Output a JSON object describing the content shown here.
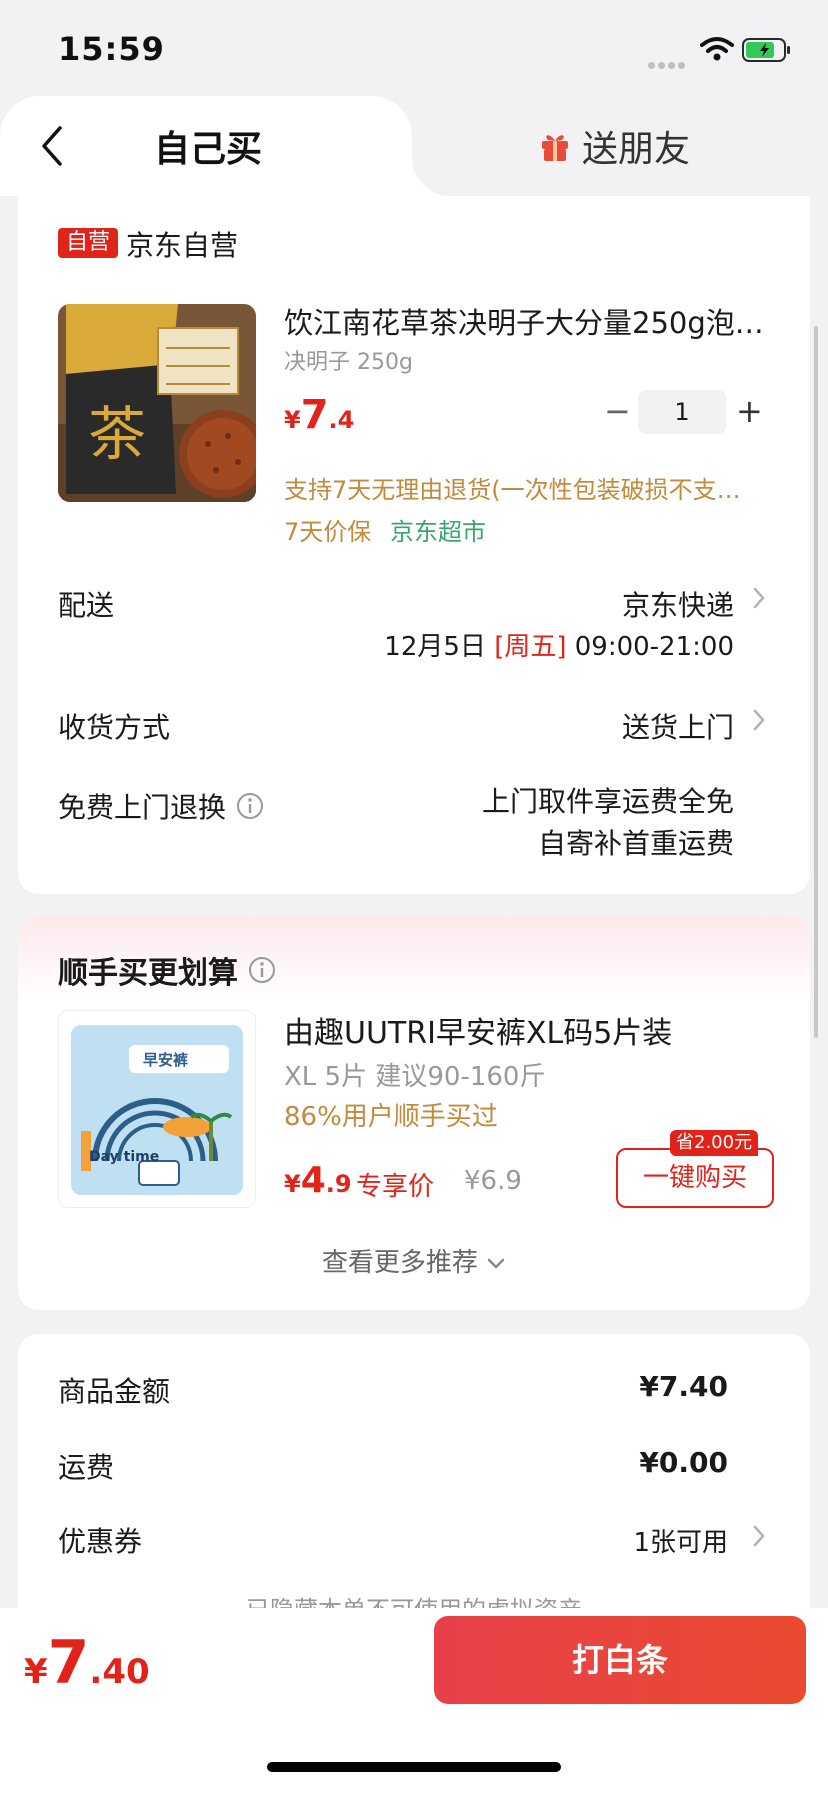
{
  "status_bar": {
    "time": "15:59",
    "battery_level": 0.7
  },
  "tabs": [
    {
      "label": "自己买",
      "active": true
    },
    {
      "label": "送朋友",
      "icon": "gift-icon",
      "active": false
    }
  ],
  "shop": {
    "badge": "自营",
    "name": "京东自营"
  },
  "product": {
    "title": "饮江南花草茶决明子大分量250g泡…",
    "spec": "决明子 250g",
    "price_currency": "¥",
    "price_int": "7",
    "price_dec": ".4",
    "quantity": "1",
    "qty_minus": "−",
    "qty_plus": "+",
    "return_policy": "支持7天无理由退货(一次性包装破损不支…",
    "price_protect": "7天价保",
    "market": "京东超市",
    "image_text": "茶"
  },
  "delivery": {
    "label": "配送",
    "carrier": "京东快递",
    "date": "12月5日",
    "weekday": "[周五]",
    "time": "09:00-21:00"
  },
  "receive": {
    "label": "收货方式",
    "value": "送货上门"
  },
  "free_return": {
    "label": "免费上门退换",
    "line1": "上门取件享运费全免",
    "line2": "自寄补首重运费"
  },
  "recommend": {
    "title": "顺手买更划算",
    "item": {
      "name": "由趣UUTRI早安裤XL码5片装",
      "spec": "XL 5片 建议90-160斤",
      "social": "86%用户顺手买过",
      "price_currency": "¥",
      "price_int": "4",
      "price_dec": ".9",
      "price_tag": "专享价",
      "orig_price": "¥6.9",
      "save_badge": "省2.00元",
      "buy_label": "一键购买",
      "image_text_1": "Day time",
      "image_text_2": "早安裤"
    },
    "more_label": "查看更多推荐"
  },
  "summary": {
    "goods_label": "商品金额",
    "goods_value": "¥7.40",
    "shipping_label": "运费",
    "shipping_value": "¥0.00",
    "coupon_label": "优惠券",
    "coupon_value": "1张可用",
    "hidden_note": "已隐藏本单不可使用的虚拟资产"
  },
  "footer": {
    "total_currency": "¥",
    "total_int": "7",
    "total_dec": ".40",
    "pay_label": "打白条"
  },
  "colors": {
    "brand_red": "#e2231a",
    "gold": "#c18a3c",
    "green": "#3aa66e"
  }
}
